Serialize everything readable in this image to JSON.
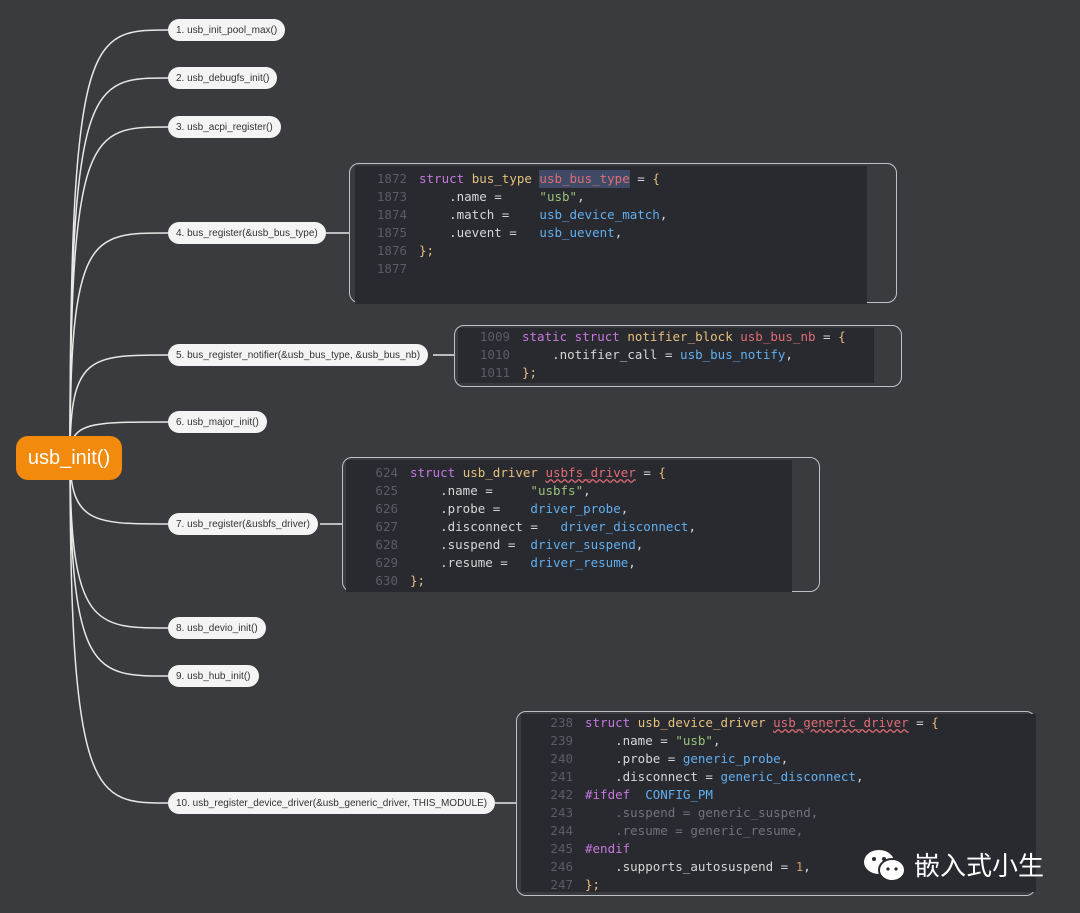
{
  "root": {
    "label": "usb_init()",
    "color": "#f28a0e"
  },
  "nodes": [
    {
      "label": "1. usb_init_pool_max()"
    },
    {
      "label": "2. usb_debugfs_init()"
    },
    {
      "label": "3. usb_acpi_register()"
    },
    {
      "label": "4. bus_register(&usb_bus_type)"
    },
    {
      "label": "5. bus_register_notifier(&usb_bus_type, &usb_bus_nb)"
    },
    {
      "label": "6. usb_major_init()"
    },
    {
      "label": "7. usb_register(&usbfs_driver)"
    },
    {
      "label": "8. usb_devio_init()"
    },
    {
      "label": "9. usb_hub_init()"
    },
    {
      "label": "10. usb_register_device_driver(&usb_generic_driver, THIS_MODULE)"
    }
  ],
  "code_blocks": [
    {
      "lines": [
        {
          "n": "1872",
          "t": [
            [
              "struct ",
              "kw"
            ],
            [
              "bus_type ",
              "ty"
            ],
            [
              "usb_bus_type",
              "vr hl"
            ],
            [
              " = ",
              "op"
            ],
            [
              "{",
              "pu"
            ]
          ]
        },
        {
          "n": "1873",
          "t": [
            [
              "    .name =     ",
              "op"
            ],
            [
              "\"usb\"",
              "st"
            ],
            [
              ",",
              "op"
            ]
          ]
        },
        {
          "n": "1874",
          "t": [
            [
              "    .match =    ",
              "op"
            ],
            [
              "usb_device_match",
              "fn"
            ],
            [
              ",",
              "op"
            ]
          ]
        },
        {
          "n": "1875",
          "t": [
            [
              "    .uevent =   ",
              "op"
            ],
            [
              "usb_uevent",
              "fn"
            ],
            [
              ",",
              "op"
            ]
          ]
        },
        {
          "n": "1876",
          "t": [
            [
              "};",
              "pu"
            ]
          ]
        },
        {
          "n": "1877",
          "t": []
        }
      ]
    },
    {
      "lines": [
        {
          "n": "1009",
          "t": [
            [
              "static struct ",
              "kw"
            ],
            [
              "notifier_block ",
              "ty"
            ],
            [
              "usb_bus_nb",
              "vr"
            ],
            [
              " = ",
              "op"
            ],
            [
              "{",
              "pu"
            ]
          ]
        },
        {
          "n": "1010",
          "t": [
            [
              "    .notifier_call = ",
              "op"
            ],
            [
              "usb_bus_notify",
              "fn"
            ],
            [
              ",",
              "op"
            ]
          ]
        },
        {
          "n": "1011",
          "t": [
            [
              "};",
              "pu"
            ]
          ]
        }
      ]
    },
    {
      "lines": [
        {
          "n": "624",
          "t": [
            [
              "struct ",
              "kw"
            ],
            [
              "usb_driver ",
              "ty"
            ],
            [
              "usbfs_driver",
              "vr sq"
            ],
            [
              " = ",
              "op"
            ],
            [
              "{",
              "pu"
            ]
          ]
        },
        {
          "n": "625",
          "t": [
            [
              "    .name =     ",
              "op"
            ],
            [
              "\"usbfs\"",
              "st"
            ],
            [
              ",",
              "op"
            ]
          ]
        },
        {
          "n": "626",
          "t": [
            [
              "    .probe =    ",
              "op"
            ],
            [
              "driver_probe",
              "fn"
            ],
            [
              ",",
              "op"
            ]
          ]
        },
        {
          "n": "627",
          "t": [
            [
              "    .disconnect =   ",
              "op"
            ],
            [
              "driver_disconnect",
              "fn"
            ],
            [
              ",",
              "op"
            ]
          ]
        },
        {
          "n": "628",
          "t": [
            [
              "    .suspend =  ",
              "op"
            ],
            [
              "driver_suspend",
              "fn"
            ],
            [
              ",",
              "op"
            ]
          ]
        },
        {
          "n": "629",
          "t": [
            [
              "    .resume =   ",
              "op"
            ],
            [
              "driver_resume",
              "fn"
            ],
            [
              ",",
              "op"
            ]
          ]
        },
        {
          "n": "630",
          "t": [
            [
              "};",
              "pu"
            ]
          ]
        }
      ]
    },
    {
      "lines": [
        {
          "n": "238",
          "t": [
            [
              "struct ",
              "kw"
            ],
            [
              "usb_device_driver ",
              "ty"
            ],
            [
              "usb_generic_driver",
              "vr sq"
            ],
            [
              " = ",
              "op"
            ],
            [
              "{",
              "pu"
            ]
          ]
        },
        {
          "n": "239",
          "t": [
            [
              "    .name = ",
              "op"
            ],
            [
              "\"usb\"",
              "st"
            ],
            [
              ",",
              "op"
            ]
          ]
        },
        {
          "n": "240",
          "t": [
            [
              "    .probe = ",
              "op"
            ],
            [
              "generic_probe",
              "fn"
            ],
            [
              ",",
              "op"
            ]
          ]
        },
        {
          "n": "241",
          "t": [
            [
              "    .disconnect = ",
              "op"
            ],
            [
              "generic_disconnect",
              "fn"
            ],
            [
              ",",
              "op"
            ]
          ]
        },
        {
          "n": "242",
          "t": [
            [
              "#ifdef  ",
              "pp"
            ],
            [
              "CONFIG_PM",
              "mc"
            ]
          ]
        },
        {
          "n": "243",
          "t": [
            [
              "    .suspend = generic_suspend,",
              "dim"
            ]
          ]
        },
        {
          "n": "244",
          "t": [
            [
              "    .resume = generic_resume,",
              "dim"
            ]
          ]
        },
        {
          "n": "245",
          "t": [
            [
              "#endif",
              "pp"
            ]
          ]
        },
        {
          "n": "246",
          "t": [
            [
              "    .supports_autosuspend = ",
              "op"
            ],
            [
              "1",
              "nm"
            ],
            [
              ",",
              "op"
            ]
          ]
        },
        {
          "n": "247",
          "t": [
            [
              "};",
              "pu"
            ]
          ]
        }
      ]
    }
  ],
  "watermark": {
    "text": "嵌入式小生",
    "icon": "wechat-icon"
  }
}
